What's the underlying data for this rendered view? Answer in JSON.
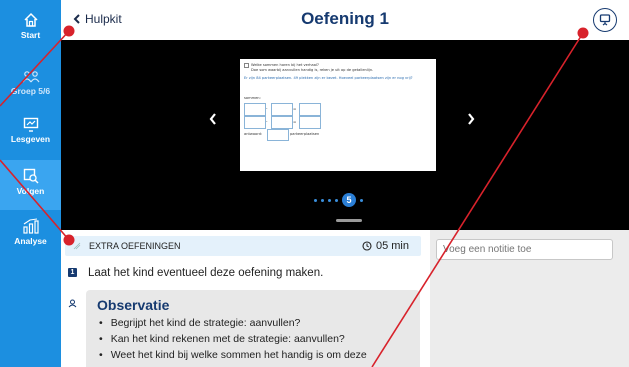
{
  "sidebar": {
    "items": [
      {
        "label": "Start",
        "icon": "home-icon"
      },
      {
        "label": "Groep 5/6",
        "icon": "group-icon"
      },
      {
        "label": "Lesgeven",
        "icon": "lesson-icon"
      },
      {
        "label": "Volgen",
        "icon": "follow-icon"
      },
      {
        "label": "Analyse",
        "icon": "analysis-icon"
      }
    ]
  },
  "header": {
    "back_label": "Hulpkit",
    "title": "Oefening 1"
  },
  "slide": {
    "question": "Welke sommen horen bij het verhaal?",
    "subtitle": "Doe som waarbij aanvullen handig is, reken je uit op de getallenlijn.",
    "story": "Er zijn 84 parkeerplaatsen. 49 plekken zijn er bezet. Hoeveel parkeerplaatsen zijn er nog vrij?",
    "sommen_label": "sommen:",
    "op_minus": "-",
    "op_eq": "=",
    "antwoord_label": "antwoord:",
    "antwoord_suffix": "parkeerplaatsen",
    "current_page": "5"
  },
  "lesson": {
    "section_title": "EXTRA OEFENINGEN",
    "duration": "05 min",
    "step_number": "1",
    "step_text": "Laat het kind eventueel deze oefening maken.",
    "observation_title": "Observatie",
    "observation_items": [
      "Begrijpt het kind de strategie: aanvullen?",
      "Kan het kind rekenen met de strategie: aanvullen?",
      "Weet het kind bij welke sommen het handig is om deze"
    ]
  },
  "notes": {
    "placeholder": "Voeg een notitie toe"
  },
  "colors": {
    "sidebar": "#1c8fe0",
    "title": "#163a70",
    "section_bar": "#e4f1fb",
    "annotation": "#d8222b"
  }
}
